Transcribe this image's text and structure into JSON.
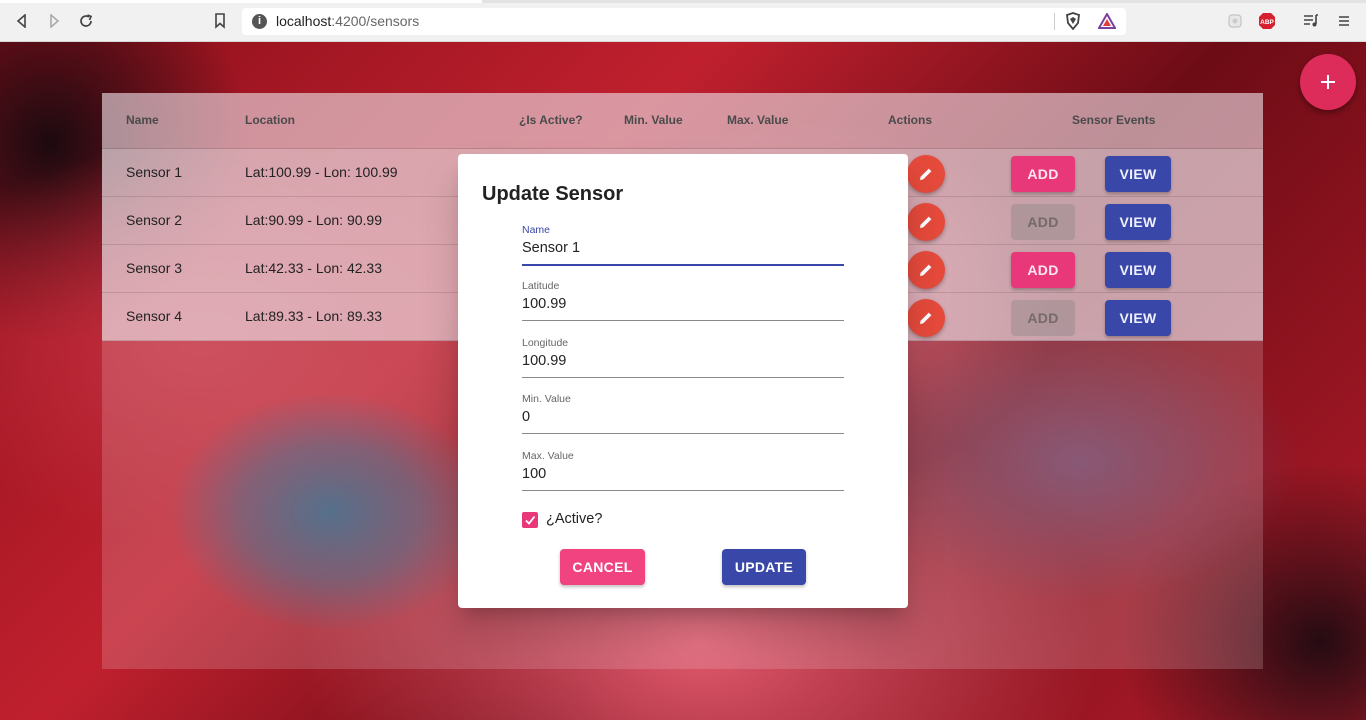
{
  "browser": {
    "url_host": "localhost",
    "url_path": ":4200/sensors",
    "info_icon": "info-icon"
  },
  "table": {
    "headers": {
      "name": "Name",
      "location": "Location",
      "is_active": "¿Is Active?",
      "min_value": "Min. Value",
      "max_value": "Max. Value",
      "actions": "Actions",
      "sensor_events": "Sensor Events"
    },
    "rows": [
      {
        "name": "Sensor 1",
        "location": "Lat:100.99 - Lon: 100.99",
        "add_enabled": true
      },
      {
        "name": "Sensor 2",
        "location": "Lat:90.99 - Lon: 90.99",
        "add_enabled": false
      },
      {
        "name": "Sensor 3",
        "location": "Lat:42.33 - Lon: 42.33",
        "add_enabled": true
      },
      {
        "name": "Sensor 4",
        "location": "Lat:89.33 - Lon: 89.33",
        "add_enabled": false
      }
    ],
    "add_label": "ADD",
    "view_label": "VIEW"
  },
  "dialog": {
    "title": "Update Sensor",
    "fields": {
      "name": {
        "label": "Name",
        "value": "Sensor 1"
      },
      "latitude": {
        "label": "Latitude",
        "value": "100.99"
      },
      "longitude": {
        "label": "Longitude",
        "value": "100.99"
      },
      "min_value": {
        "label": "Min. Value",
        "value": "0"
      },
      "max_value": {
        "label": "Max. Value",
        "value": "100"
      }
    },
    "active_label": "¿Active?",
    "active_checked": true,
    "cancel_label": "CANCEL",
    "update_label": "UPDATE"
  },
  "colors": {
    "primary": "#3947a8",
    "accent": "#e8387a",
    "warn": "#e64a3b"
  }
}
